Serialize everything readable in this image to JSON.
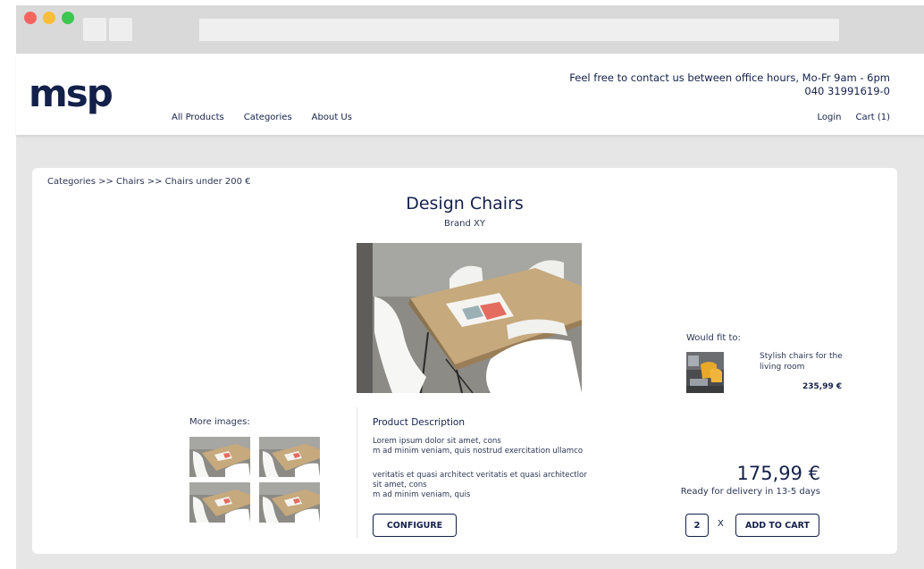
{
  "header": {
    "logo": "msp",
    "nav": [
      "All Products",
      "Categories",
      "About Us"
    ],
    "contact_line1": "Feel free to contact us between office hours, Mo-Fr 9am - 6pm",
    "contact_line2": "040 31991619-0",
    "login": "Login",
    "cart": "Cart (1)"
  },
  "breadcrumb": "Categories >> Chairs >> Chairs under 200 €",
  "product": {
    "title": "Design Chairs",
    "brand": "Brand XY"
  },
  "more_images": {
    "label": "More images:"
  },
  "description": {
    "title": "Product Description",
    "p1_line1": "Lorem ipsum dolor sit amet, cons",
    "p1_line2": "m ad minim veniam, quis nostrud exercitation ullamco",
    "p2_line1": "veritatis et quasi architect veritatis et quasi architectlor",
    "p2_line2": "sit amet, cons",
    "p2_line3": "m ad minim veniam, quis",
    "configure_label": "CONFIGURE"
  },
  "would_fit": {
    "label": "Would fit to:",
    "item_name": "Stylish chairs for the living room",
    "item_price": "235,99 €"
  },
  "purchase": {
    "price": "175,99 €",
    "delivery": "Ready for delivery in 13-5 days",
    "quantity": "2",
    "times": "X",
    "add_to_cart_label": "ADD TO CART"
  },
  "colors": {
    "brand": "#13204a",
    "background": "#e6e6e6"
  }
}
